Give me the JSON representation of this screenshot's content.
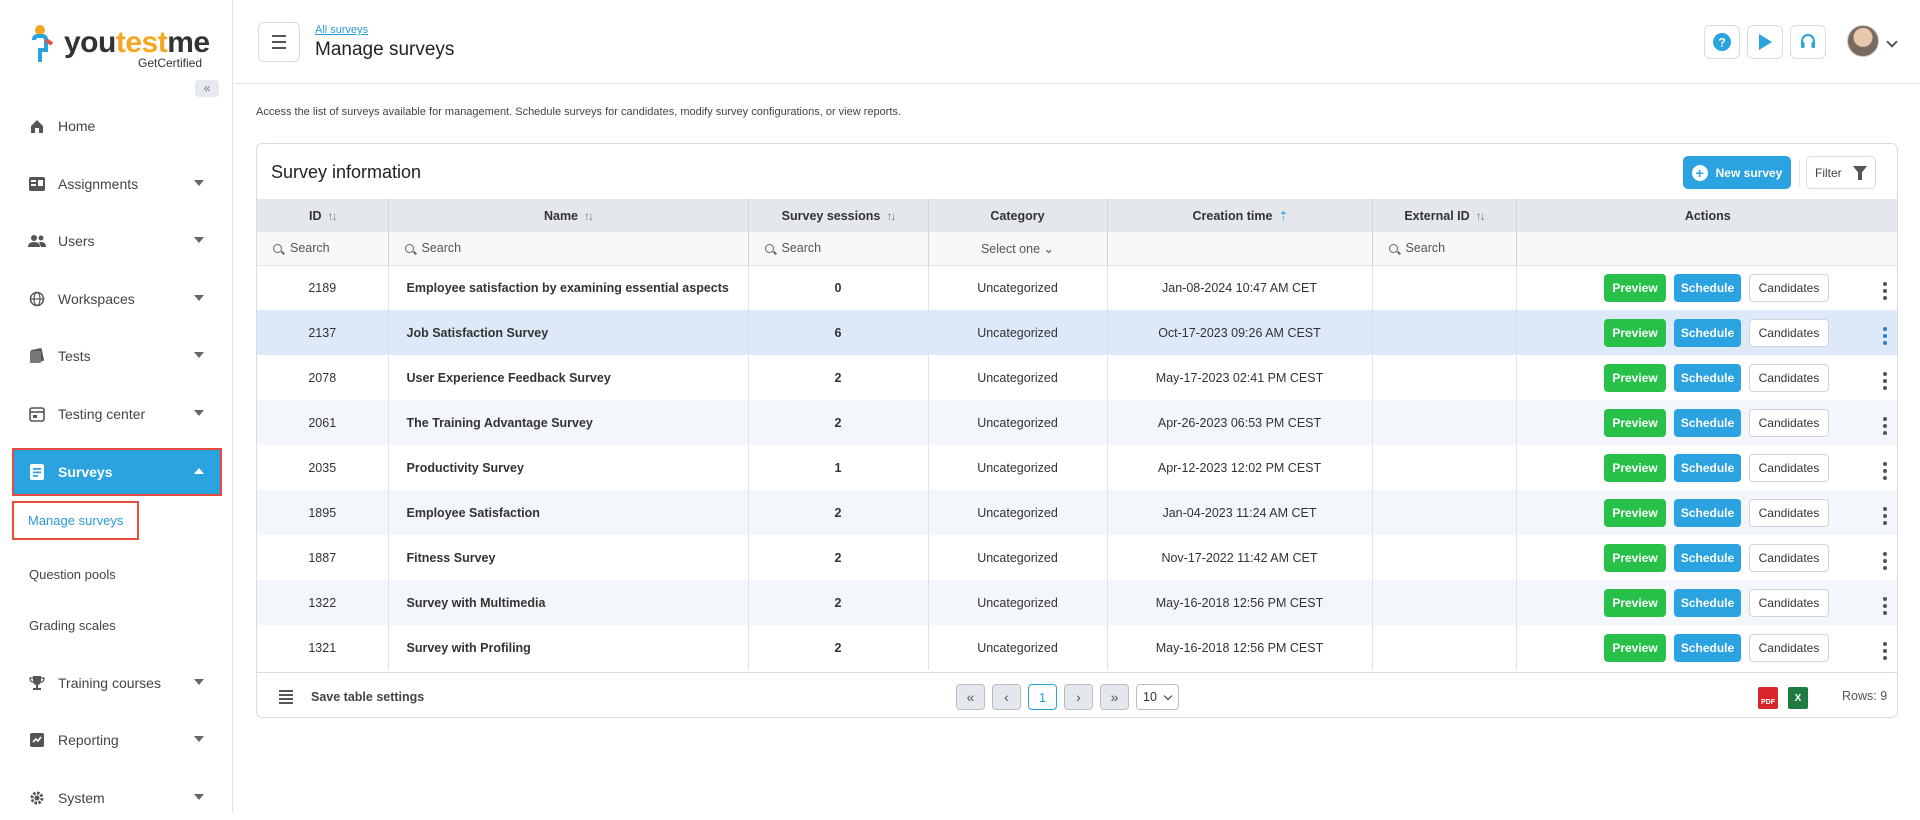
{
  "brand": {
    "name_a": "you",
    "name_b": "test",
    "name_c": "me",
    "sub": "GetCertified"
  },
  "sidebar": {
    "items": [
      {
        "label": "Home"
      },
      {
        "label": "Assignments"
      },
      {
        "label": "Users"
      },
      {
        "label": "Workspaces"
      },
      {
        "label": "Tests"
      },
      {
        "label": "Testing center"
      },
      {
        "label": "Surveys"
      },
      {
        "label": "Training courses"
      },
      {
        "label": "Reporting"
      },
      {
        "label": "System"
      }
    ],
    "sub_items": [
      {
        "label": "Manage surveys"
      },
      {
        "label": "Question pools"
      },
      {
        "label": "Grading scales"
      }
    ]
  },
  "header": {
    "breadcrumb": "All surveys",
    "title": "Manage surveys"
  },
  "description": "Access the list of surveys available for management. Schedule surveys for candidates, modify survey configurations, or view reports.",
  "panel": {
    "title": "Survey information",
    "new_button": "New survey",
    "filter_button": "Filter"
  },
  "table": {
    "columns": [
      "ID",
      "Name",
      "Survey sessions",
      "Category",
      "Creation time",
      "External ID",
      "Actions"
    ],
    "search_placeholder": "Search",
    "category_placeholder": "Select one",
    "rows": [
      {
        "id": "2189",
        "name": "Employee satisfaction by examining essential aspects",
        "sessions": "0",
        "category": "Uncategorized",
        "created": "Jan-08-2024 10:47 AM CET"
      },
      {
        "id": "2137",
        "name": "Job Satisfaction Survey",
        "sessions": "6",
        "category": "Uncategorized",
        "created": "Oct-17-2023 09:26 AM CEST"
      },
      {
        "id": "2078",
        "name": "User Experience Feedback Survey",
        "sessions": "2",
        "category": "Uncategorized",
        "created": "May-17-2023 02:41 PM CEST"
      },
      {
        "id": "2061",
        "name": "The Training Advantage Survey",
        "sessions": "2",
        "category": "Uncategorized",
        "created": "Apr-26-2023 06:53 PM CEST"
      },
      {
        "id": "2035",
        "name": "Productivity Survey",
        "sessions": "1",
        "category": "Uncategorized",
        "created": "Apr-12-2023 12:02 PM CEST"
      },
      {
        "id": "1895",
        "name": "Employee Satisfaction",
        "sessions": "2",
        "category": "Uncategorized",
        "created": "Jan-04-2023 11:24 AM CET"
      },
      {
        "id": "1887",
        "name": "Fitness Survey",
        "sessions": "2",
        "category": "Uncategorized",
        "created": "Nov-17-2022 11:42 AM CET"
      },
      {
        "id": "1322",
        "name": "Survey with Multimedia",
        "sessions": "2",
        "category": "Uncategorized",
        "created": "May-16-2018 12:56 PM CEST"
      },
      {
        "id": "1321",
        "name": "Survey with Profiling",
        "sessions": "2",
        "category": "Uncategorized",
        "created": "May-16-2018 12:56 PM CEST"
      }
    ],
    "actions": {
      "preview": "Preview",
      "schedule": "Schedule",
      "candidates": "Candidates"
    }
  },
  "footer": {
    "save_settings": "Save table settings",
    "current_page": "1",
    "rows_per_page": "10",
    "rows_count": "Rows: 9",
    "pdf_label": "PDF",
    "xls_label": "X"
  },
  "colors": {
    "accent": "#2aa3e0",
    "preview": "#27c14a",
    "highlight": "#e74c3c"
  }
}
